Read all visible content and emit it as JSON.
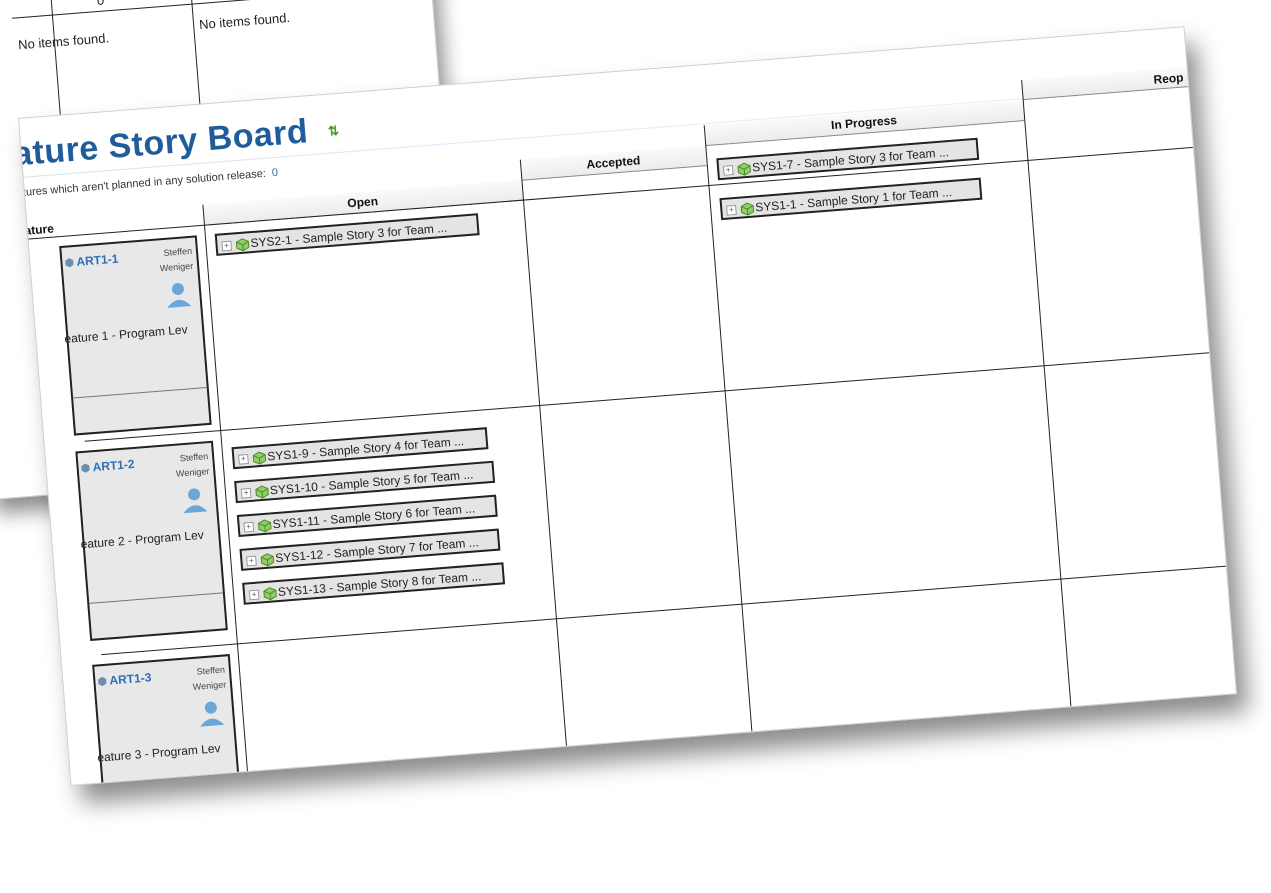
{
  "back_sheet": {
    "count_value": "0",
    "left_empty_text": "No items found.",
    "right_empty_text": "No items found."
  },
  "board": {
    "title": "eature Story Board",
    "refresh_icon": "refresh-icon",
    "unplanned_label": "atures which aren't planned in any solution release:",
    "unplanned_count": "0",
    "feature_column": "eature",
    "columns": [
      "Open",
      "Accepted",
      "In Progress",
      "Reop"
    ],
    "features": [
      {
        "id": "ART1-1",
        "owner_first": "Steffen",
        "owner_last": "Weniger",
        "title": "eature 1 - Program Lev",
        "stories": {
          "open": [
            "SYS2-1 - Sample Story 3 for Team ..."
          ],
          "in_progress": [
            "SYS1-7 - Sample Story 3 for Team ...",
            "SYS1-1 - Sample Story 1 for Team ..."
          ]
        }
      },
      {
        "id": "ART1-2",
        "owner_first": "Steffen",
        "owner_last": "Weniger",
        "title": "eature 2 - Program Lev",
        "stories": {
          "open": [
            "SYS1-9 - Sample Story 4 for Team ...",
            "SYS1-10 - Sample Story 5 for Team ...",
            "SYS1-11 - Sample Story 6 for Team ...",
            "SYS1-12 - Sample Story 7 for Team ...",
            "SYS1-13 - Sample Story 8 for Team ..."
          ],
          "in_progress": []
        }
      },
      {
        "id": "ART1-3",
        "owner_first": "Steffen",
        "owner_last": "Weniger",
        "title": "eature 3 - Program Lev",
        "stories": {
          "open": [],
          "in_progress": []
        }
      }
    ]
  }
}
